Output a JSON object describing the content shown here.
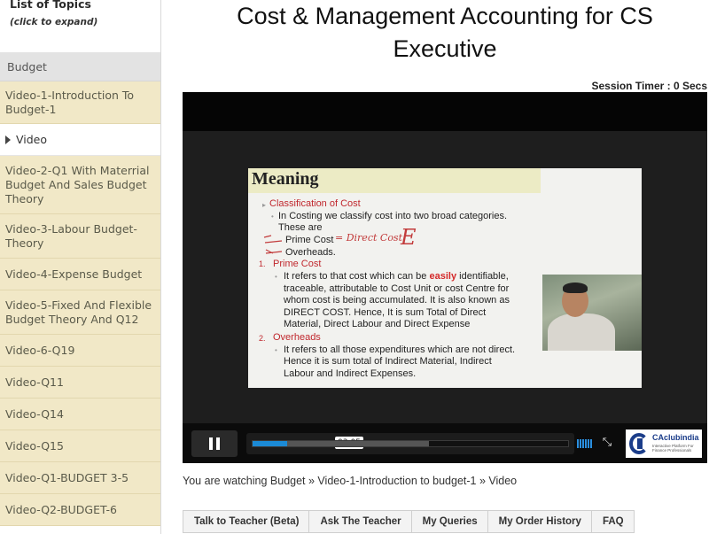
{
  "sidebar": {
    "title": "List of Topics",
    "subtitle": "(click to expand)",
    "section": "Budget",
    "items": [
      {
        "label": "Video-1-Introduction To Budget-1",
        "active": false
      },
      {
        "label": "Video",
        "active": true
      },
      {
        "label": "Video-2-Q1 With Materrial Budget And Sales Budget Theory",
        "active": false
      },
      {
        "label": "Video-3-Labour Budget-Theory",
        "active": false
      },
      {
        "label": "Video-4-Expense Budget",
        "active": false
      },
      {
        "label": "Video-5-Fixed And Flexible Budget Theory And Q12",
        "active": false
      },
      {
        "label": "Video-6-Q19",
        "active": false
      },
      {
        "label": "Video-Q11",
        "active": false
      },
      {
        "label": "Video-Q14",
        "active": false
      },
      {
        "label": "Video-Q15",
        "active": false
      },
      {
        "label": "Video-Q1-BUDGET 3-5",
        "active": false
      },
      {
        "label": "Video-Q2-BUDGET-6",
        "active": false
      }
    ]
  },
  "main": {
    "title_line1": "Cost & Management Accounting for CS",
    "title_line2": "Executive",
    "session_timer": "Session Timer : 0 Secs",
    "breadcrumb": "You are watching Budget » Video-1-Introduction to budget-1 » Video"
  },
  "player": {
    "current_time": "03:05",
    "played_fraction": 0.11,
    "buffered_fraction": 0.56,
    "slide": {
      "title": "Meaning",
      "lines": [
        "Classification of Cost",
        "In Costing we classify cost into two broad categories.",
        "These are",
        "Prime Cost",
        "Overheads.",
        "1.",
        "Prime Cost",
        "It refers to that cost which can be",
        "easily",
        "identifiable,",
        "traceable, attributable to Cost Unit or cost Centre for",
        "whom cost is being accumulated. It is also known as",
        "DIRECT COST. Hence, It is sum Total of Direct",
        "Material, Direct Labour and Direct Expense",
        "2.",
        "Overheads",
        "It refers to all those expenditures which are not direct.",
        "Hence it is sum total of Indirect Material, Indirect",
        "Labour and Indirect Expenses."
      ],
      "annotation": "= Direct Cost",
      "annotation_mark": "E"
    },
    "logo": {
      "name": "CAclubindia",
      "tagline": "Interactive Platform For Finance Professionals"
    }
  },
  "tabs": [
    {
      "label": "Talk to Teacher (Beta)"
    },
    {
      "label": "Ask The Teacher"
    },
    {
      "label": "My Queries"
    },
    {
      "label": "My Order History"
    },
    {
      "label": "FAQ"
    }
  ],
  "colors": {
    "sidebar_item_bg": "#f1e8c7",
    "progress_blue": "#1b8ad6",
    "slide_red": "#c0272d"
  }
}
